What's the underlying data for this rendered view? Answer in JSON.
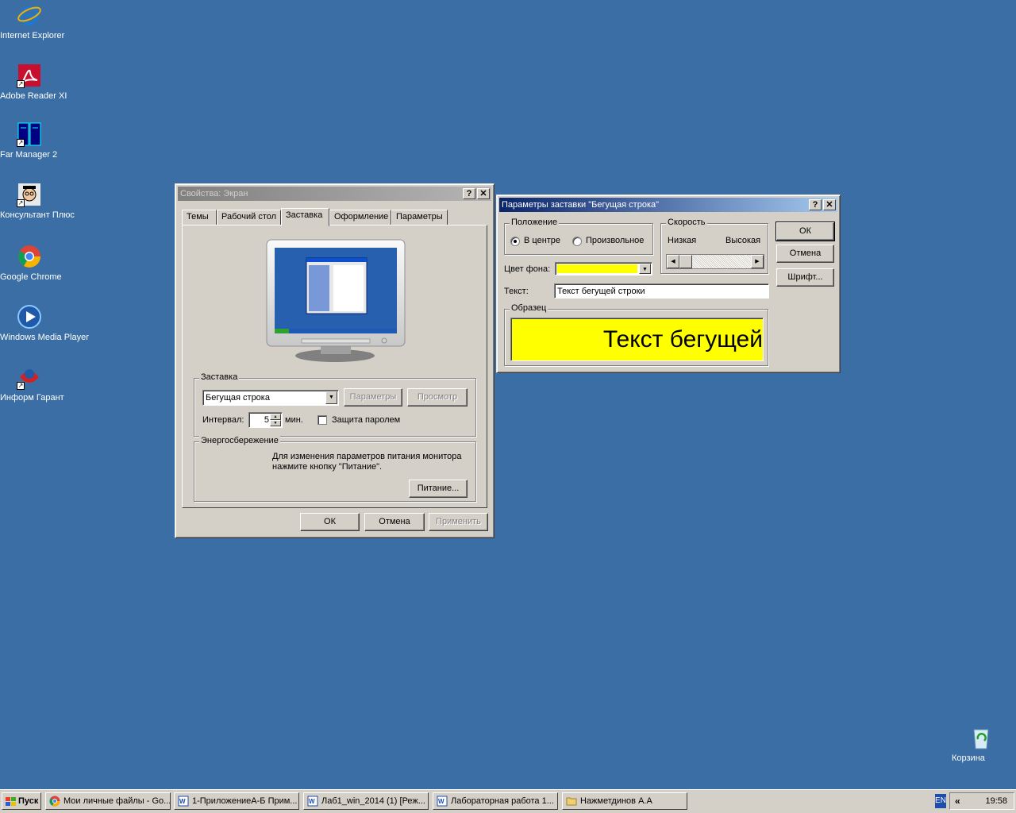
{
  "desktop": {
    "icons": [
      {
        "label": "Internet Explorer",
        "icon": "ie-icon"
      },
      {
        "label": "Adobe Reader XI",
        "icon": "pdf-icon"
      },
      {
        "label": "Far Manager 2",
        "icon": "far-manager-icon"
      },
      {
        "label": "Консультант Плюс",
        "icon": "consultant-icon"
      },
      {
        "label": "Google Chrome",
        "icon": "chrome-icon"
      },
      {
        "label": "Windows Media Player",
        "icon": "media-player-icon"
      },
      {
        "label": "Информ Гарант",
        "icon": "garant-icon"
      }
    ],
    "recycle_bin": {
      "label": "Корзина",
      "icon": "recycle-bin-icon"
    }
  },
  "display_props": {
    "title": "Свойства: Экран",
    "tabs": [
      "Темы",
      "Рабочий стол",
      "Заставка",
      "Оформление",
      "Параметры"
    ],
    "active_tab": "Заставка",
    "screensaver_group": "Заставка",
    "screensaver_value": "Бегущая строка",
    "settings_button": "Параметры",
    "preview_button": "Просмотр",
    "interval_label": "Интервал:",
    "interval_value": "5",
    "interval_unit": "мин.",
    "password_label": "Защита паролем",
    "password_checked": false,
    "energy_group": "Энергосбережение",
    "energy_text_1": "Для изменения параметров питания монитора",
    "energy_text_2": "нажмите кнопку \"Питание\".",
    "power_button": "Питание...",
    "ok": "ОК",
    "cancel": "Отмена",
    "apply": "Применить"
  },
  "marquee": {
    "title": "Параметры заставки \"Бегущая строка\"",
    "position_group": "Положение",
    "center_label": "В центре",
    "random_label": "Произвольное",
    "position_selected": "В центре",
    "speed_group": "Скорость",
    "slow_label": "Низкая",
    "fast_label": "Высокая",
    "bg_label": "Цвет фона:",
    "bg_color": "#ffff00",
    "text_label": "Текст:",
    "text_value": "Текст бегущей строки",
    "sample_group": "Образец",
    "sample_text": "Текст бегущей",
    "ok": "ОК",
    "cancel": "Отмена",
    "font": "Шрифт..."
  },
  "taskbar": {
    "start": "Пуск",
    "tasks": [
      {
        "label": "Мои личные файлы - Go...",
        "icon": "chrome-icon"
      },
      {
        "label": "1-ПриложениеА-Б Прим...",
        "icon": "word-icon"
      },
      {
        "label": "Лаб1_win_2014 (1) [Реж...",
        "icon": "word-icon"
      },
      {
        "label": "Лабораторная работа 1...",
        "icon": "word-icon"
      },
      {
        "label": "Нажметдинов А.А",
        "icon": "folder-icon"
      }
    ],
    "lang": "EN",
    "clock": "19:58"
  }
}
